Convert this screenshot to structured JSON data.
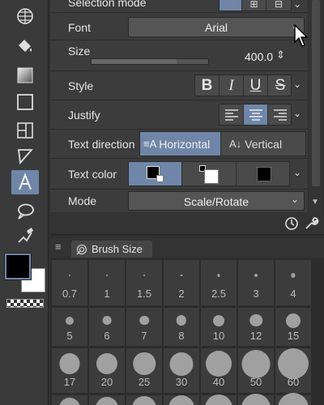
{
  "tool_property": {
    "selection_mode_label": "Selection mode",
    "font": {
      "label": "Font",
      "value": "Arial"
    },
    "size": {
      "label": "Size",
      "value": "400.0",
      "slider_fraction": 0.73
    },
    "style": {
      "label": "Style",
      "buttons": [
        "B",
        "I",
        "U",
        "S"
      ]
    },
    "justify": {
      "label": "Justify",
      "options": [
        "left",
        "center",
        "right"
      ],
      "selected": "center"
    },
    "text_direction": {
      "label": "Text direction",
      "options": [
        "Horizontal",
        "Vertical"
      ],
      "selected": "Horizontal"
    },
    "text_color": {
      "label": "Text color",
      "options": [
        "main color",
        "sub color",
        "user color"
      ],
      "selected": "main color"
    },
    "mode": {
      "label": "Mode",
      "value": "Scale/Rotate"
    }
  },
  "brush_size_palette": {
    "tab_label": "Brush Size",
    "row1": [
      "0.7",
      "1",
      "1.5",
      "2",
      "2.5",
      "3",
      "4"
    ],
    "row2": [
      "5",
      "6",
      "7",
      "8",
      "10",
      "12",
      "15"
    ],
    "row3": [
      "17",
      "20",
      "25",
      "30",
      "40",
      "50",
      "60"
    ]
  },
  "colors": {
    "accent": "#6f86a8",
    "panel": "#3c3c3c",
    "main_color": "#000000",
    "sub_color": "#ffffff"
  },
  "icons": {
    "toolbar": [
      "navigator-icon",
      "fill-icon",
      "gradient-icon",
      "rectangle-icon",
      "frame-border-icon",
      "ruler-icon",
      "text-icon",
      "balloon-icon",
      "correct-line-icon"
    ]
  }
}
